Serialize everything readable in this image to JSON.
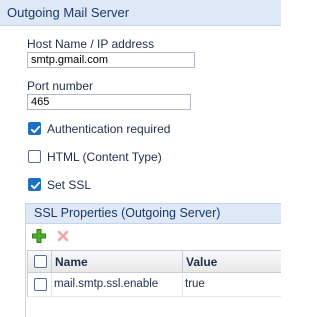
{
  "panel": {
    "title": "Outgoing Mail Server"
  },
  "host": {
    "label": "Host Name / IP address",
    "value": "smtp.gmail.com"
  },
  "port": {
    "label": "Port number",
    "value": "465"
  },
  "checkboxes": [
    {
      "label": "Authentication required",
      "checked": true
    },
    {
      "label": "HTML (Content Type)",
      "checked": false
    },
    {
      "label": "Set SSL",
      "checked": true
    }
  ],
  "ssl": {
    "title": "SSL Properties (Outgoing Server)",
    "toolbar": {
      "add_icon": "plus-icon",
      "delete_icon": "x-icon"
    },
    "columns": [
      "Name",
      "Value"
    ],
    "rows": [
      {
        "name": "mail.smtp.ssl.enable",
        "value": "true",
        "checked": false
      }
    ]
  },
  "colors": {
    "header_bg": "#dfe8f6",
    "checkbox_checked": "#1f6fc5",
    "add_green": "#3a9a1f",
    "delete_red": "#f4a6a6"
  }
}
